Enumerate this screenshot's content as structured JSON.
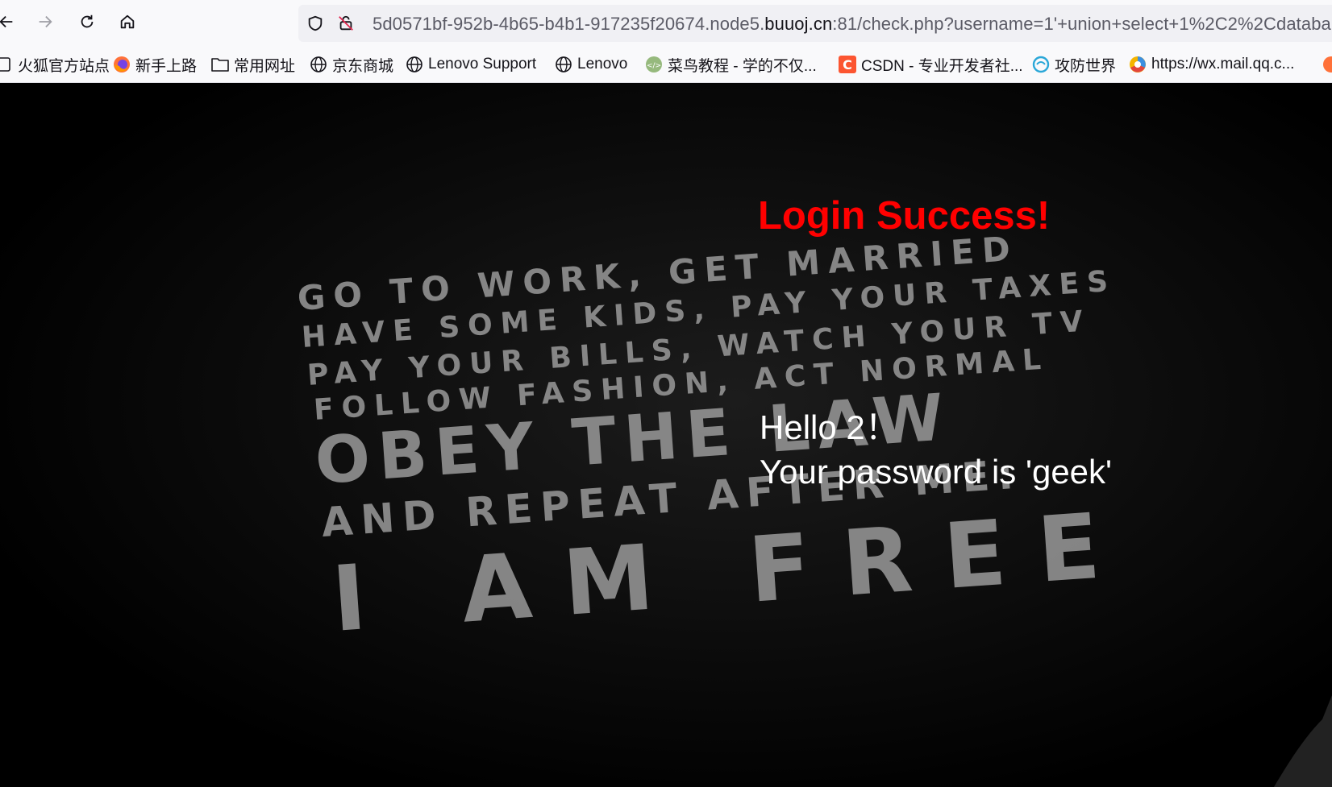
{
  "browser": {
    "url_prefix": "5d0571bf-952b-4b65-b4b1-917235f20674.node5.",
    "url_host": "buuoj.cn",
    "url_suffix": ":81/check.php?username=1'+union+select+1%2C2%2Cdataba",
    "nav": {
      "back_icon": "arrow-left-icon",
      "forward_icon": "arrow-right-icon",
      "reload_icon": "reload-icon",
      "home_icon": "home-icon"
    }
  },
  "bookmarks": [
    {
      "label": "火狐官方站点",
      "icon": "page-icon"
    },
    {
      "label": "新手上路",
      "icon": "firefox-icon"
    },
    {
      "label": "常用网址",
      "icon": "folder-icon"
    },
    {
      "label": "京东商城",
      "icon": "globe-icon"
    },
    {
      "label": "Lenovo Support",
      "icon": "globe-icon"
    },
    {
      "label": "Lenovo",
      "icon": "globe-icon"
    },
    {
      "label": "菜鸟教程 - 学的不仅...",
      "icon": "runoob-icon"
    },
    {
      "label": "CSDN - 专业开发者社...",
      "icon": "csdn-icon"
    },
    {
      "label": "攻防世界",
      "icon": "gongfang-icon"
    },
    {
      "label": "https://wx.mail.qq.c...",
      "icon": "qq-mail-icon"
    }
  ],
  "page": {
    "title": "Login Success!",
    "hello": "Hello 2！",
    "password_line": "Your password is 'geek'"
  },
  "background_text": [
    "GO TO WORK, GET MARRIED",
    "HAVE SOME KIDS, PAY YOUR TAXES",
    "PAY YOUR BILLS, WATCH YOUR TV",
    "FOLLOW FASHION, ACT NORMAL",
    "OBEY THE LAW",
    "AND REPEAT AFTER ME:",
    "I AM FREE"
  ],
  "colors": {
    "title": "#ff0000",
    "text": "#ffffff",
    "background": "#000000"
  }
}
